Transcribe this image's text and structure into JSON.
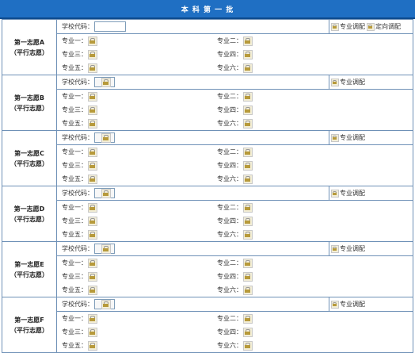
{
  "header": {
    "title": "本 科 第 一 批"
  },
  "labels": {
    "school_code": "学校代码：",
    "major_1": "专业一：",
    "major_2": "专业二：",
    "major_3": "专业三：",
    "major_4": "专业四：",
    "major_5": "专业五：",
    "major_6": "专业六：",
    "major_adjust": "专业调配",
    "targeted_adjust": "定向调配",
    "parallel": "（平行志愿）"
  },
  "choices": [
    {
      "name": "第一志愿A",
      "subtitle": "（平行志愿）",
      "code_empty": true,
      "show_targeted": true
    },
    {
      "name": "第一志愿B",
      "subtitle": "（平行志愿）",
      "code_empty": false,
      "show_targeted": false
    },
    {
      "name": "第一志愿C",
      "subtitle": "（平行志愿）",
      "code_empty": false,
      "show_targeted": false
    },
    {
      "name": "第一志愿D",
      "subtitle": "（平行志愿）",
      "code_empty": false,
      "show_targeted": false
    },
    {
      "name": "第一志愿E",
      "subtitle": "（平行志愿）",
      "code_empty": false,
      "show_targeted": false
    },
    {
      "name": "第一志愿F",
      "subtitle": "（平行志愿）",
      "code_empty": false,
      "show_targeted": false
    }
  ]
}
